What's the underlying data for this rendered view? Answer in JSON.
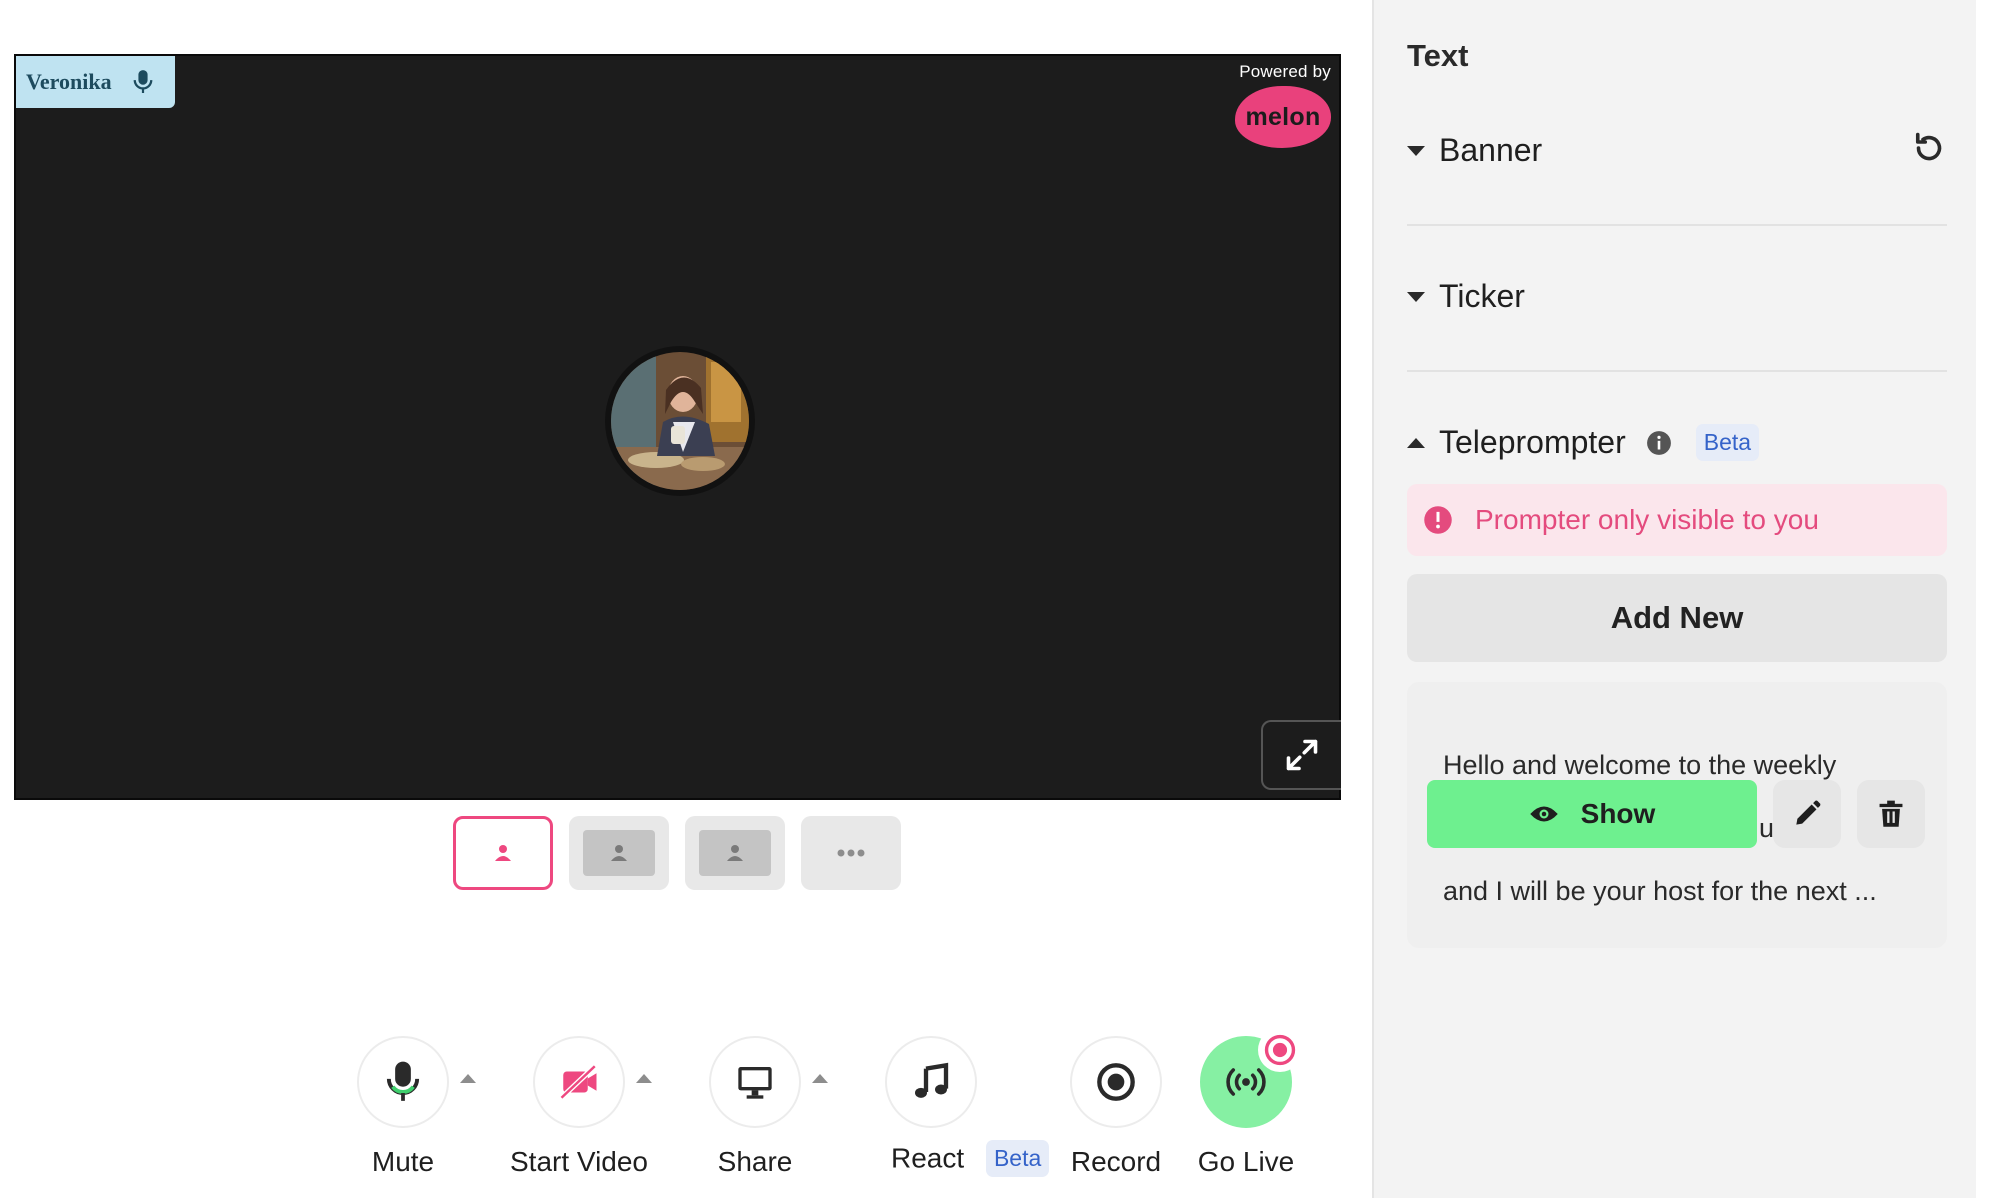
{
  "stage": {
    "participant_name": "Veronika",
    "powered_by": "Powered by",
    "brand": "melon"
  },
  "controls": {
    "mute": "Mute",
    "start_video": "Start Video",
    "share": "Share",
    "react": "React",
    "react_badge": "Beta",
    "record": "Record",
    "go_live": "Go Live"
  },
  "sidebar": {
    "title": "Text",
    "sections": {
      "banner": "Banner",
      "ticker": "Ticker",
      "teleprompter": "Teleprompter",
      "teleprompter_badge": "Beta"
    },
    "notice": "Prompter only visible to you",
    "add_new": "Add New",
    "prompt": {
      "lines": [
        "Hello and welcome to the weekly",
        "ur w",
        "V ka",
        "and I will be your host for the next ..."
      ],
      "show_label": "Show"
    }
  },
  "colors": {
    "accent_pink": "#ee4880",
    "live_green": "#86f0a3",
    "show_green": "#6ef08f",
    "beta_blue": "#3563c9"
  }
}
